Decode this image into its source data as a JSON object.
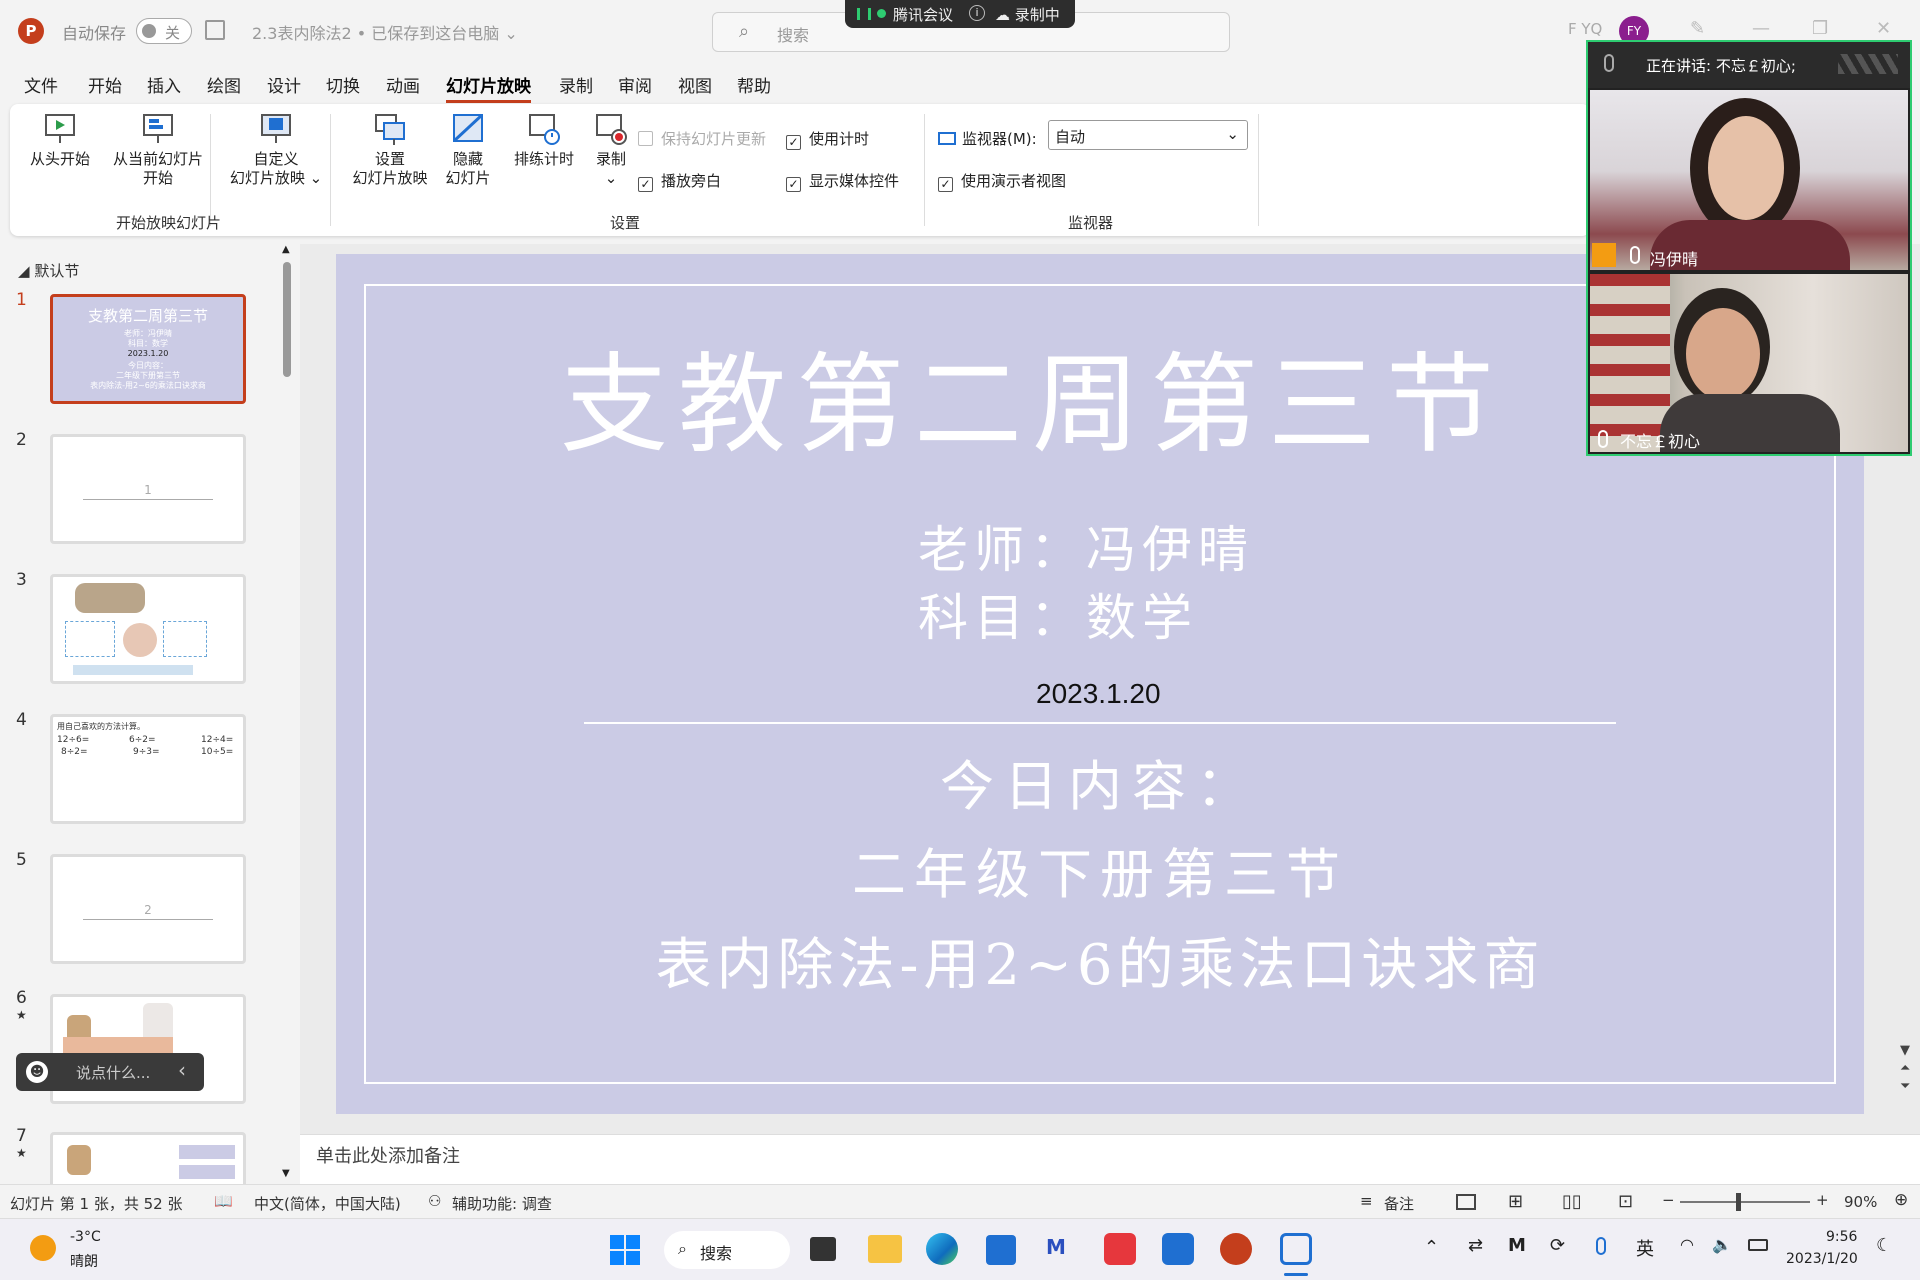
{
  "titlebar": {
    "logo": "P",
    "autosave": "自动保存",
    "toggle": "关",
    "doc": "2.3表内除法2 • 已保存到这台电脑 ⌄",
    "search_placeholder": "搜索",
    "user": "F YQ",
    "avatar": "FY"
  },
  "meeting": {
    "app": "腾讯会议",
    "info": "i",
    "recording": "☁ 录制中"
  },
  "menu": [
    "文件",
    "开始",
    "插入",
    "绘图",
    "设计",
    "切换",
    "动画",
    "幻灯片放映",
    "录制",
    "审阅",
    "视图",
    "帮助"
  ],
  "ribbon": {
    "from_start": "从头开始",
    "from_current_1": "从当前幻灯片",
    "from_current_2": "开始",
    "custom_1": "自定义",
    "custom_2": "幻灯片放映 ⌄",
    "group_start": "开始放映幻灯片",
    "setup_1": "设置",
    "setup_2": "幻灯片放映",
    "hide_1": "隐藏",
    "hide_2": "幻灯片",
    "rehearse": "排练计时",
    "record_1": "录制",
    "record_2": "⌄",
    "keep_updated": "保持幻灯片更新",
    "use_timings": "使用计时",
    "play_narration": "播放旁白",
    "show_media": "显示媒体控件",
    "group_setup": "设置",
    "monitor_label": "监视器(M):",
    "monitor_value": "自动",
    "presenter_view": "使用演示者视图",
    "group_monitor": "监视器"
  },
  "thumbs": {
    "section": "默认节",
    "nums": [
      "1",
      "2",
      "3",
      "4",
      "5",
      "6",
      "7"
    ],
    "star": "★",
    "slide1_title": "支教第二周第三节",
    "slide1_l1": "老师：冯伊晴",
    "slide1_l2": "科目：数学",
    "slide1_l3": "2023.1.20",
    "slide1_l4": "今日内容：",
    "slide1_l5": "二年级下册第三节",
    "slide1_l6": "表内除法-用2~6的乘法口诀求商",
    "slide2_label": "1",
    "slide4_header": "用自己喜欢的方法计算。",
    "slide4_r1": [
      "12÷6=",
      "6÷2=",
      "12÷4="
    ],
    "slide4_r2": [
      "8÷2=",
      "9÷3=",
      "10÷5="
    ],
    "slide5_label": "2"
  },
  "chat": {
    "placeholder": "说点什么...",
    "arrow": "‹"
  },
  "slide": {
    "title": "支教第二周第三节",
    "teacher": "老师：冯伊晴",
    "subject": "科目：数学",
    "date": "2023.1.20",
    "today": "今日内容：",
    "grade": "二年级下册第三节",
    "topic": "表内除法-用2~6的乘法口诀求商"
  },
  "video": {
    "speaking": "正在讲话: 不忘￡初心;",
    "p1": "冯伊晴",
    "p2": "不忘￡初心"
  },
  "notes": "单击此处添加备注",
  "status": {
    "slide_count": "幻灯片 第 1 张，共 52 张",
    "language": "中文(简体，中国大陆)",
    "accessibility": "辅助功能: 调查",
    "notes_btn": "备注",
    "zoom": "90%",
    "minus": "−",
    "plus": "+"
  },
  "taskbar": {
    "temp": "-3°C",
    "weather": "晴朗",
    "search": "搜索",
    "ime": "英",
    "time": "9:56",
    "date": "2023/1/20"
  },
  "colors": {
    "accent": "#c43e1c",
    "slide_bg": "#cbcbe5",
    "meeting_green": "#2ecc71"
  }
}
